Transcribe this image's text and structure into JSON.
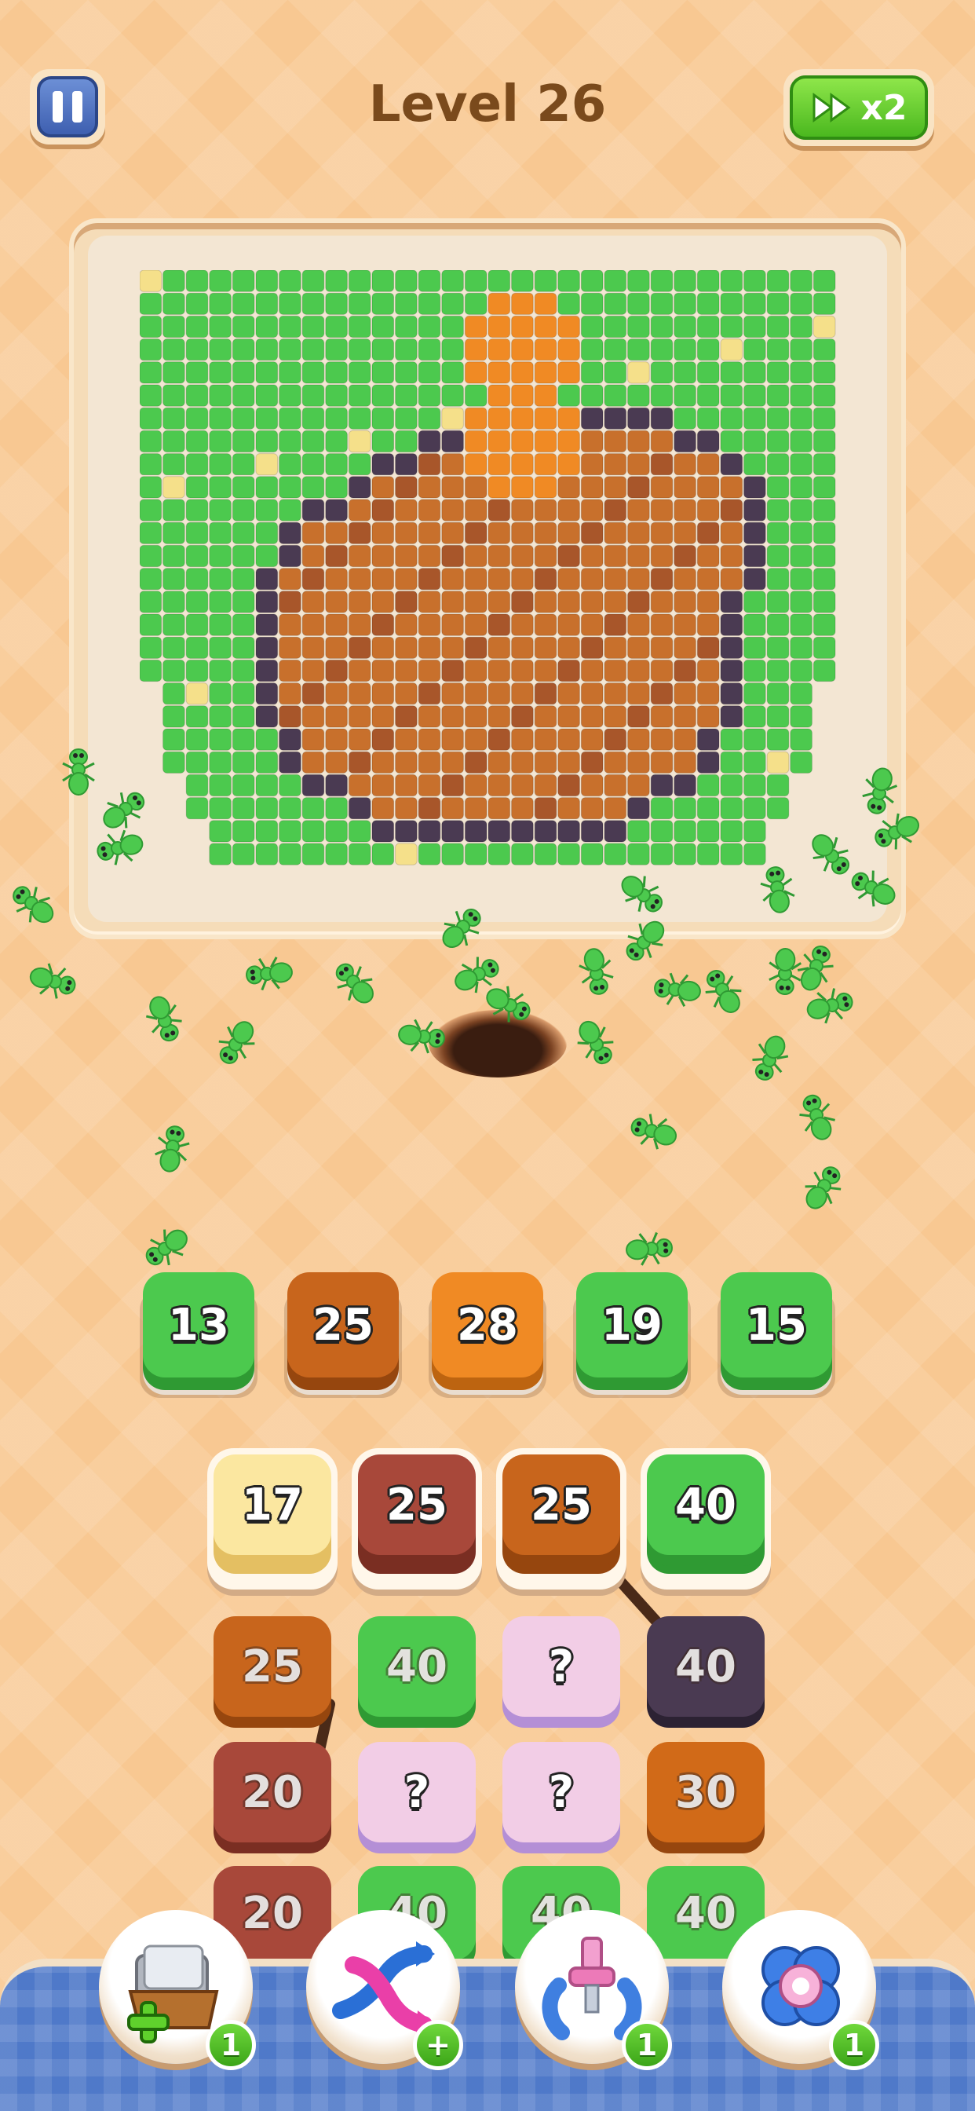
{
  "header": {
    "level_title": "Level 26",
    "speed_label": "x2"
  },
  "collection_slots": [
    {
      "number": "13",
      "color": "#4cc94e",
      "shade": "#2f9a33"
    },
    {
      "number": "25",
      "color": "#c8651c",
      "shade": "#96460e"
    },
    {
      "number": "28",
      "color": "#f08a24",
      "shade": "#bd6410"
    },
    {
      "number": "19",
      "color": "#4cc94e",
      "shade": "#2f9a33"
    },
    {
      "number": "15",
      "color": "#4cc94e",
      "shade": "#2f9a33"
    }
  ],
  "stack_rows": [
    [
      {
        "number": "17",
        "color": "#fbe7a0",
        "shade": "#e4bf62",
        "active": true
      },
      {
        "number": "25",
        "color": "#a8483a",
        "shade": "#7a2e22",
        "active": true
      },
      {
        "number": "25",
        "color": "#c8651c",
        "shade": "#96460e",
        "active": true
      },
      {
        "number": "40",
        "color": "#4cc94e",
        "shade": "#2f9a33",
        "active": true
      }
    ],
    [
      {
        "number": "25",
        "color": "#c8651c",
        "shade": "#96460e",
        "active": false
      },
      {
        "number": "40",
        "color": "#4cc94e",
        "shade": "#2f9a33",
        "active": false
      },
      {
        "number": "?",
        "color": "#f2cde6",
        "shade": "#b48fd6",
        "active": false
      },
      {
        "number": "40",
        "color": "#4a3a52",
        "shade": "#2c2233",
        "active": false
      }
    ],
    [
      {
        "number": "20",
        "color": "#a8483a",
        "shade": "#7a2e22",
        "active": false
      },
      {
        "number": "?",
        "color": "#f2cde6",
        "shade": "#b48fd6",
        "active": false
      },
      {
        "number": "?",
        "color": "#f2cde6",
        "shade": "#b48fd6",
        "active": false
      },
      {
        "number": "30",
        "color": "#d16a18",
        "shade": "#96460e",
        "active": false
      }
    ],
    [
      {
        "number": "20",
        "color": "#a8483a",
        "shade": "#7a2e22",
        "active": false
      },
      {
        "number": "40",
        "color": "#4cc94e",
        "shade": "#2f9a33",
        "active": false
      },
      {
        "number": "40",
        "color": "#4cc94e",
        "shade": "#2f9a33",
        "active": false
      },
      {
        "number": "40",
        "color": "#4cc94e",
        "shade": "#2f9a33",
        "active": false
      }
    ]
  ],
  "boosters": [
    {
      "name": "add-slot-booster",
      "icon": "tray-plus-icon",
      "count": "1"
    },
    {
      "name": "shuffle-booster",
      "icon": "shuffle-arrows-icon",
      "count": "+"
    },
    {
      "name": "magnet-booster",
      "icon": "magnet-icon",
      "count": "1"
    },
    {
      "name": "flower-booster",
      "icon": "flower-icon",
      "count": "1"
    }
  ],
  "colors": {
    "grass": "#4cc94e",
    "grass_light": "#f5e08a",
    "capybara": "#c8702c",
    "capybara_dark": "#a8562a",
    "outline": "#4a3a52",
    "orange": "#f08a24",
    "background": "#f8c892"
  }
}
